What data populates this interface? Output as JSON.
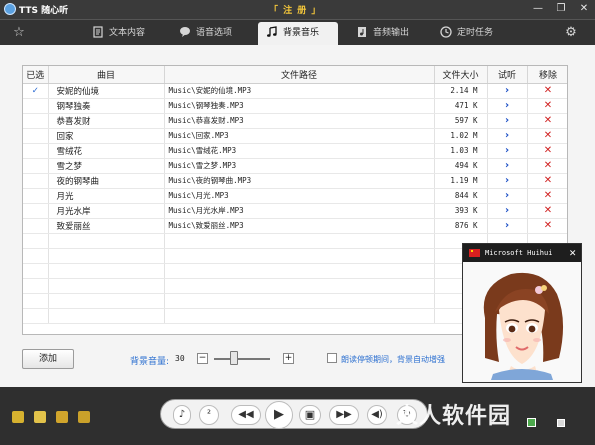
{
  "window": {
    "title": "TTS 随心听",
    "register_label": "「 注 册 」",
    "minimize": "—",
    "restore": "❐",
    "close": "✕"
  },
  "tabs": [
    {
      "label": "文本内容",
      "icon": "document-icon"
    },
    {
      "label": "语音选项",
      "icon": "speech-bubble-icon"
    },
    {
      "label": "背景音乐",
      "icon": "music-note-icon",
      "active": true
    },
    {
      "label": "音频输出",
      "icon": "audio-file-icon"
    },
    {
      "label": "定时任务",
      "icon": "clock-icon"
    }
  ],
  "table": {
    "headers": [
      "已选",
      "曲目",
      "文件路径",
      "文件大小",
      "试听",
      "移除"
    ],
    "rows": [
      {
        "selected": "✓",
        "name": "安妮的仙境",
        "path": "Music\\安妮的仙境.MP3",
        "size": "2.14 M",
        "listen": "›",
        "remove": "✕"
      },
      {
        "selected": "",
        "name": "钢琴独奏",
        "path": "Music\\钢琴独奏.MP3",
        "size": "471 K",
        "listen": "›",
        "remove": "✕"
      },
      {
        "selected": "",
        "name": "恭喜发财",
        "path": "Music\\恭喜发财.MP3",
        "size": "597 K",
        "listen": "›",
        "remove": "✕"
      },
      {
        "selected": "",
        "name": "回家",
        "path": "Music\\回家.MP3",
        "size": "1.02 M",
        "listen": "›",
        "remove": "✕"
      },
      {
        "selected": "",
        "name": "雪绒花",
        "path": "Music\\雪绒花.MP3",
        "size": "1.03 M",
        "listen": "›",
        "remove": "✕"
      },
      {
        "selected": "",
        "name": "雪之梦",
        "path": "Music\\雪之梦.MP3",
        "size": "494 K",
        "listen": "›",
        "remove": "✕"
      },
      {
        "selected": "",
        "name": "夜的钢琴曲",
        "path": "Music\\夜的钢琴曲.MP3",
        "size": "1.19 M",
        "listen": "›",
        "remove": "✕"
      },
      {
        "selected": "",
        "name": "月光",
        "path": "Music\\月光.MP3",
        "size": "844 K",
        "listen": "›",
        "remove": "✕"
      },
      {
        "selected": "",
        "name": "月光水岸",
        "path": "Music\\月光水岸.MP3",
        "size": "393 K",
        "listen": "›",
        "remove": "✕"
      },
      {
        "selected": "",
        "name": "致爱丽丝",
        "path": "Music\\致爱丽丝.MP3",
        "size": "876 K",
        "listen": "›",
        "remove": "✕"
      }
    ]
  },
  "controls": {
    "add_label": "添加",
    "volume_label": "背景音量:",
    "volume_value": "30",
    "minus": "−",
    "plus": "+",
    "auto_label": "朗读停顿期间，背景自动增强"
  },
  "voice_panel": {
    "title": "Microsoft Huihui",
    "close": "✕"
  },
  "player": {
    "speak": "♪",
    "person": "²",
    "rewind": "◀◀",
    "play": "▶",
    "stop": "▣",
    "forward": "▶▶",
    "volume": "◀)",
    "loop": "↻"
  },
  "watermark": "人人软件园"
}
